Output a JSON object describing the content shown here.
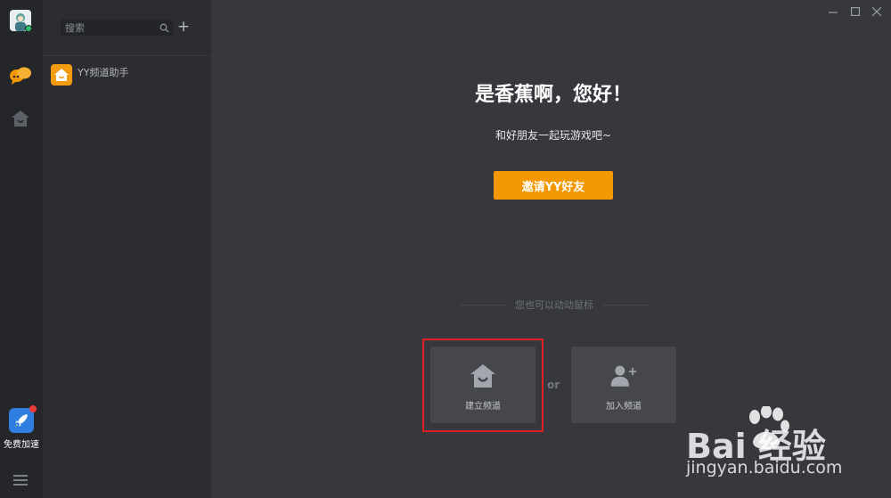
{
  "rail": {
    "boost_label": "免费加速"
  },
  "panel": {
    "search_placeholder": "搜索",
    "channel_item_label": "YY频道助手"
  },
  "main": {
    "greeting": "是香蕉啊，您好！",
    "subtitle": "和好朋友一起玩游戏吧~",
    "invite_button": "邀请YY好友",
    "hint": "您也可以动动鼠标",
    "create_channel": "建立频道",
    "join_channel": "加入频道",
    "or_text": "or"
  },
  "watermark": {
    "brand": "Bai 经验",
    "url": "jingyan.baidu.com"
  },
  "colors": {
    "accent": "#f39800",
    "highlight": "#e02020",
    "online": "#29c26a"
  }
}
